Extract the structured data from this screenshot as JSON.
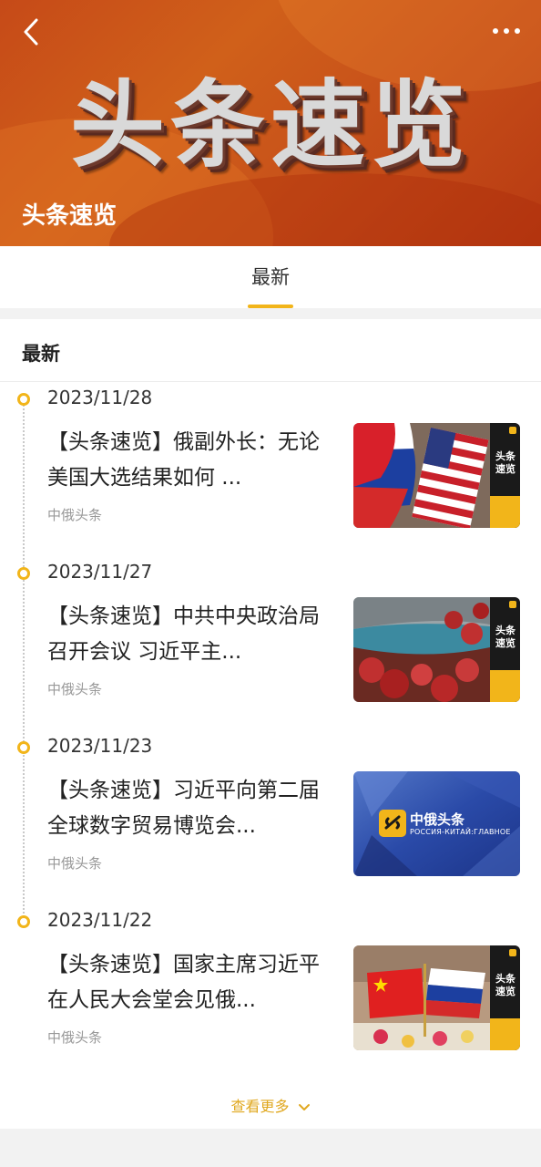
{
  "header": {
    "banner_title": "头条速览",
    "subtitle": "头条速览",
    "back_icon": "chevron-left-icon",
    "more_icon": "more-horizontal-icon"
  },
  "tabs": [
    {
      "label": "最新",
      "active": true
    }
  ],
  "section": {
    "title": "最新"
  },
  "entries": [
    {
      "date": "2023/11/28",
      "headline": "【头条速览】俄副外长：无论美国大选结果如何 ...",
      "source": "中俄头条",
      "thumb": "russia-us-flags-image"
    },
    {
      "date": "2023/11/27",
      "headline": "【头条速览】中共中央政治局召开会议 习近平主...",
      "source": "中俄头条",
      "thumb": "red-leaves-river-image"
    },
    {
      "date": "2023/11/23",
      "headline": "【头条速览】习近平向第二届全球数字贸易博览会...",
      "source": "中俄头条",
      "thumb": "zhonge-toutiao-logo-image"
    },
    {
      "date": "2023/11/22",
      "headline": "【头条速览】国家主席习近平在人民大会堂会见俄...",
      "source": "中俄头条",
      "thumb": "china-russia-flags-image"
    }
  ],
  "thumb_badge": {
    "line1": "头条",
    "line2": "速览"
  },
  "logo_card": {
    "title": "中俄头条",
    "subtitle": "РОССИЯ-КИТАЙ:ГЛАВНОЕ"
  },
  "view_more": {
    "label": "查看更多",
    "icon": "chevron-down-icon"
  },
  "colors": {
    "accent": "#f2b51a",
    "banner": "#c8521a",
    "badge_bg": "#1a1a1a"
  }
}
